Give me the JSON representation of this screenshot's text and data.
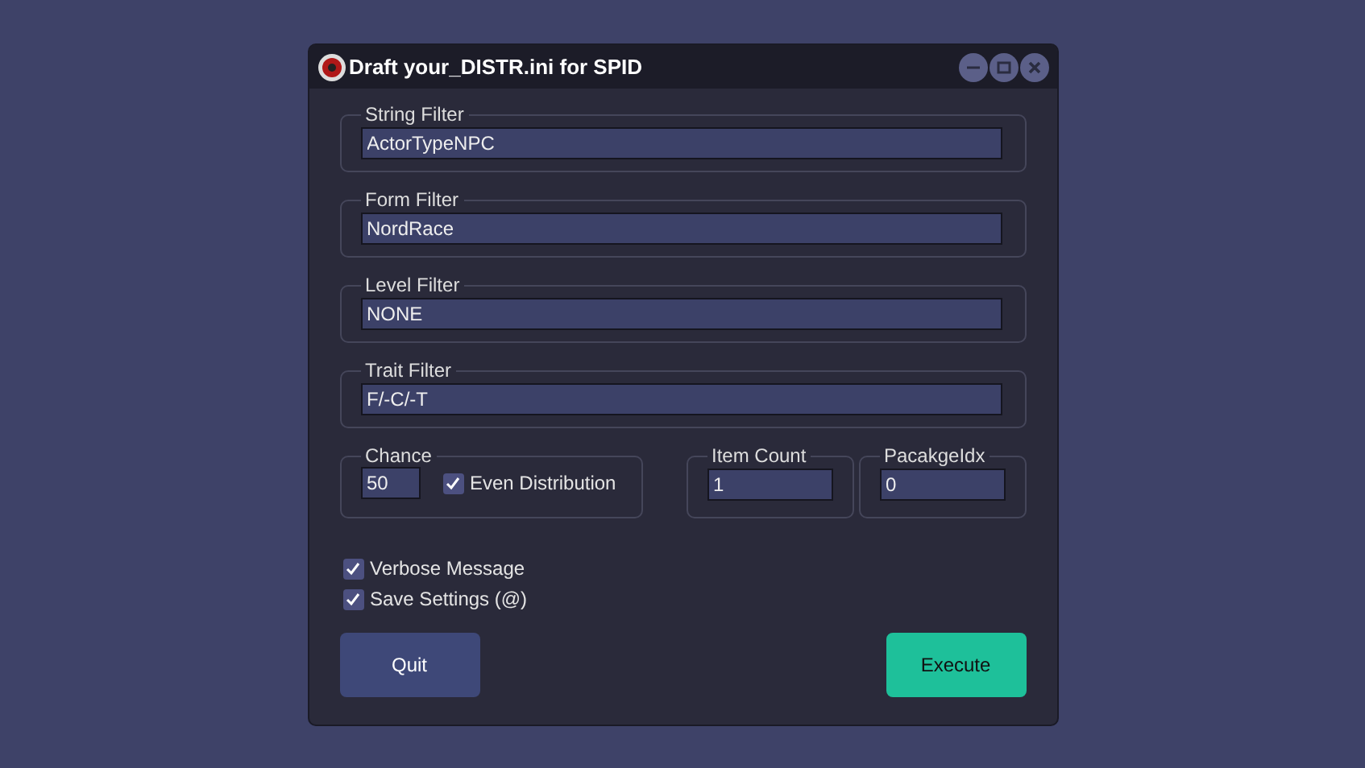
{
  "window": {
    "title": "Draft your_DISTR.ini for SPID"
  },
  "filters": [
    {
      "label": "String Filter",
      "value": "ActorTypeNPC"
    },
    {
      "label": "Form Filter",
      "value": "NordRace"
    },
    {
      "label": "Level Filter",
      "value": "NONE"
    },
    {
      "label": "Trait Filter",
      "value": "F/-C/-T"
    }
  ],
  "chance": {
    "label": "Chance",
    "value": "50",
    "even_distribution": {
      "label": "Even Distribution",
      "checked": true
    }
  },
  "item_count": {
    "label": "Item Count",
    "value": "1"
  },
  "package_idx": {
    "label": "PacakgeIdx",
    "value": "0"
  },
  "options": [
    {
      "label": "Verbose Message",
      "checked": true
    },
    {
      "label": "Save Settings (@)",
      "checked": true
    }
  ],
  "buttons": [
    {
      "label": "Quit",
      "kind": "secondary"
    },
    {
      "label": "Execute",
      "kind": "primary"
    }
  ]
}
